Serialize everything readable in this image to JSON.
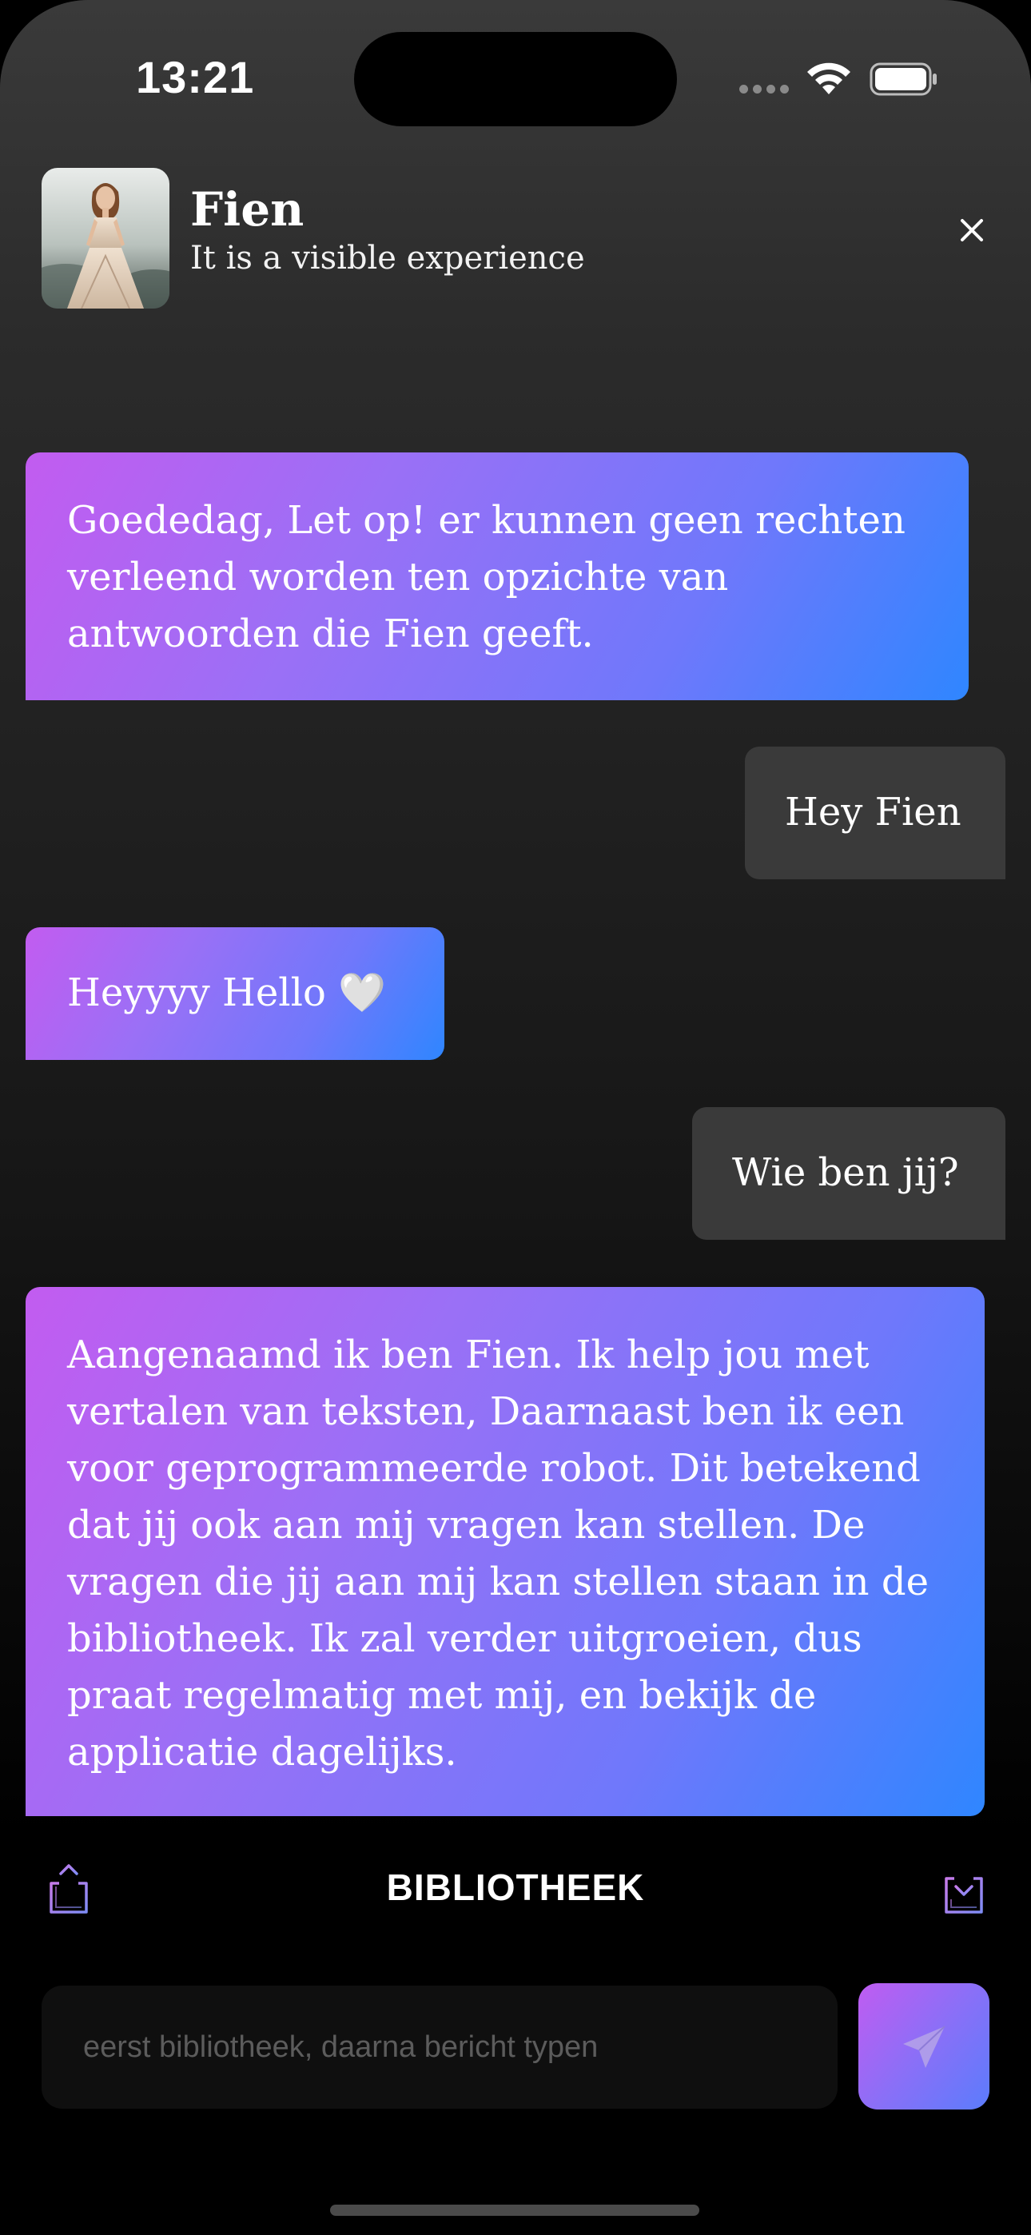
{
  "status_bar": {
    "time": "13:21"
  },
  "header": {
    "name": "Fien",
    "subtitle": "It is a visible experience",
    "close_icon": "close-icon"
  },
  "messages": [
    {
      "sender": "bot",
      "text": "Goededag, Let op! er kunnen geen rechten verleend worden ten opzichte van antwoorden die Fien geeft."
    },
    {
      "sender": "user",
      "text": "Hey Fien"
    },
    {
      "sender": "bot",
      "text": "Heyyyy Hello 🤍"
    },
    {
      "sender": "user",
      "text": "Wie ben jij?"
    },
    {
      "sender": "bot",
      "text": "Aangenaamd ik ben Fien. Ik help jou met vertalen van teksten, Daarnaast ben ik een voor geprogrammeerde robot. Dit betekend dat jij ook aan mij vragen kan stellen. De vragen die jij aan mij kan stellen staan in de bibliotheek. Ik zal verder uitgroeien, dus praat regelmatig met mij, en bekijk de applicatie dagelijks."
    }
  ],
  "library": {
    "title": "BIBLIOTHEEK",
    "left_icon": "share-export-icon",
    "right_icon": "import-download-icon"
  },
  "composer": {
    "placeholder": "eerst bibliotheek, daarna bericht typen",
    "value": "",
    "send_icon": "send-icon"
  },
  "colors": {
    "bot_gradient_start": "#c25cf0",
    "bot_gradient_end": "#2f86ff",
    "user_bubble": "#3a3a3a",
    "input_bg": "#0f0f0f"
  }
}
